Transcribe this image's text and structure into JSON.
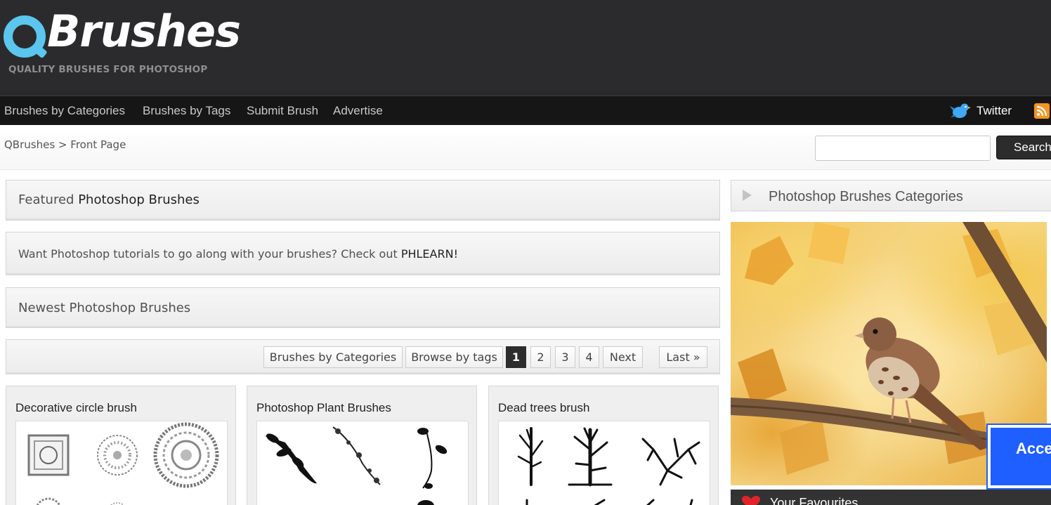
{
  "header": {
    "logo_text": "Brushes",
    "tagline": "QUALITY BRUSHES FOR PHOTOSHOP"
  },
  "nav": {
    "items": [
      {
        "label": "Brushes by Categories"
      },
      {
        "label": "Brushes by Tags"
      },
      {
        "label": "Submit Brush"
      },
      {
        "label": "Advertise"
      }
    ],
    "twitter_label": "Twitter"
  },
  "breadcrumb": {
    "home": "QBrushes",
    "separator": ">",
    "current": "Front Page"
  },
  "search": {
    "value": "",
    "button_label": "Search"
  },
  "panels": {
    "featured_prefix": "Featured",
    "featured_strong": "Photoshop Brushes",
    "promo_text": "Want Photoshop tutorials to go along with your brushes? Check out",
    "promo_link": "PHLEARN!",
    "newest_title": "Newest Photoshop Brushes"
  },
  "pager": {
    "categories_label": "Brushes by Categories",
    "tags_label": "Browse by tags",
    "pages": [
      "1",
      "2",
      "3",
      "4"
    ],
    "active_page": "1",
    "next_label": "Next",
    "last_label": "Last »"
  },
  "cards": [
    {
      "title": "Decorative circle brush"
    },
    {
      "title": "Photoshop Plant Brushes"
    },
    {
      "title": "Dead trees brush"
    }
  ],
  "sidebar": {
    "categories_title": "Photoshop Brushes Categories",
    "favourites_title": "Your Favourites",
    "accessibility_label": "Acce\nM"
  },
  "colors": {
    "header_bg": "#2b2b2d",
    "nav_bg": "#161616",
    "logo_accent": "#5bc6ee",
    "rss": "#f7931e",
    "accessibility_blue": "#1f5fff"
  },
  "icons": {
    "twitter": "twitter-bird-icon",
    "rss": "rss-icon",
    "side_arrow": "triangle-right-icon",
    "heart": "heart-icon"
  }
}
